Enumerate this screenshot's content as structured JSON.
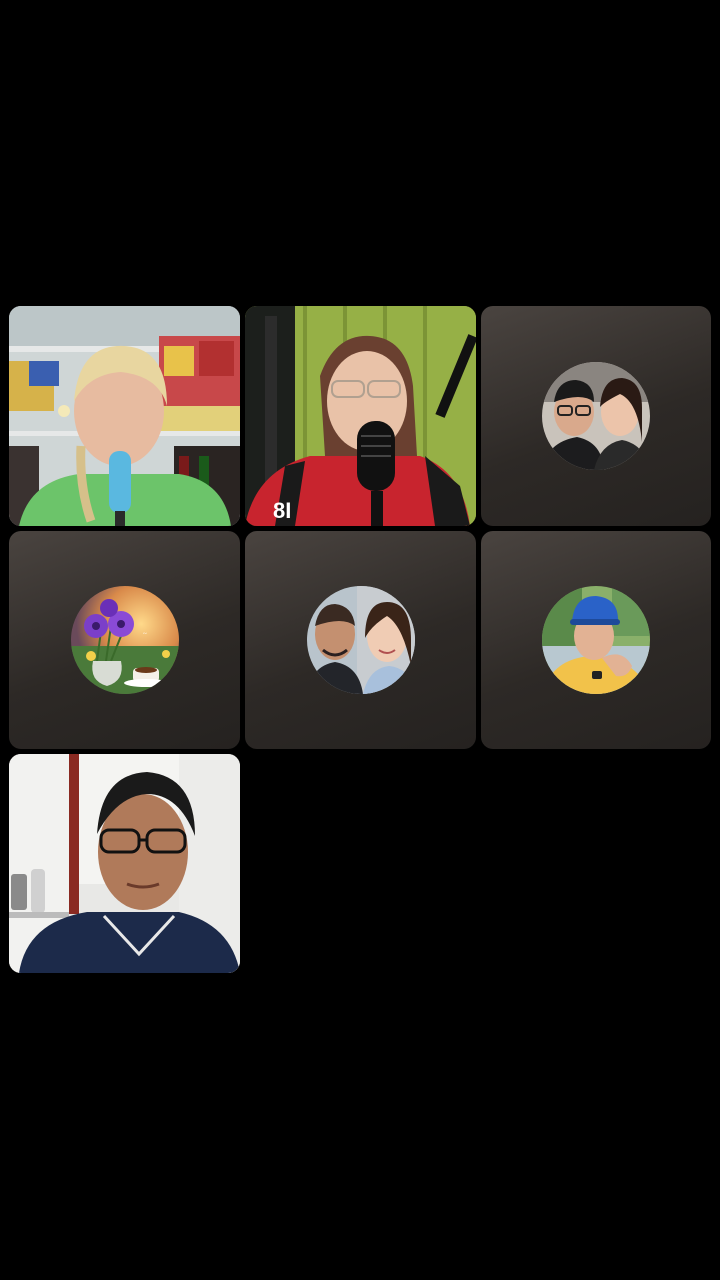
{
  "call": {
    "participants": [
      {
        "id": "p1",
        "type": "video",
        "icon": "shop-singer-video"
      },
      {
        "id": "p2",
        "type": "video",
        "icon": "singer-microphone-video"
      },
      {
        "id": "p3",
        "type": "avatar",
        "icon": "couple-avatar"
      },
      {
        "id": "p4",
        "type": "avatar",
        "icon": "flowers-coffee-avatar"
      },
      {
        "id": "p5",
        "type": "avatar",
        "icon": "couple-selfie-avatar"
      },
      {
        "id": "p6",
        "type": "avatar",
        "icon": "man-blue-cap-avatar"
      },
      {
        "id": "p7",
        "type": "video",
        "icon": "man-glasses-video"
      }
    ],
    "colors": {
      "background": "#000000",
      "tile": "#2f2b28",
      "green_curtain": "#8ea840",
      "flower_purple": "#7b3fc9"
    }
  }
}
